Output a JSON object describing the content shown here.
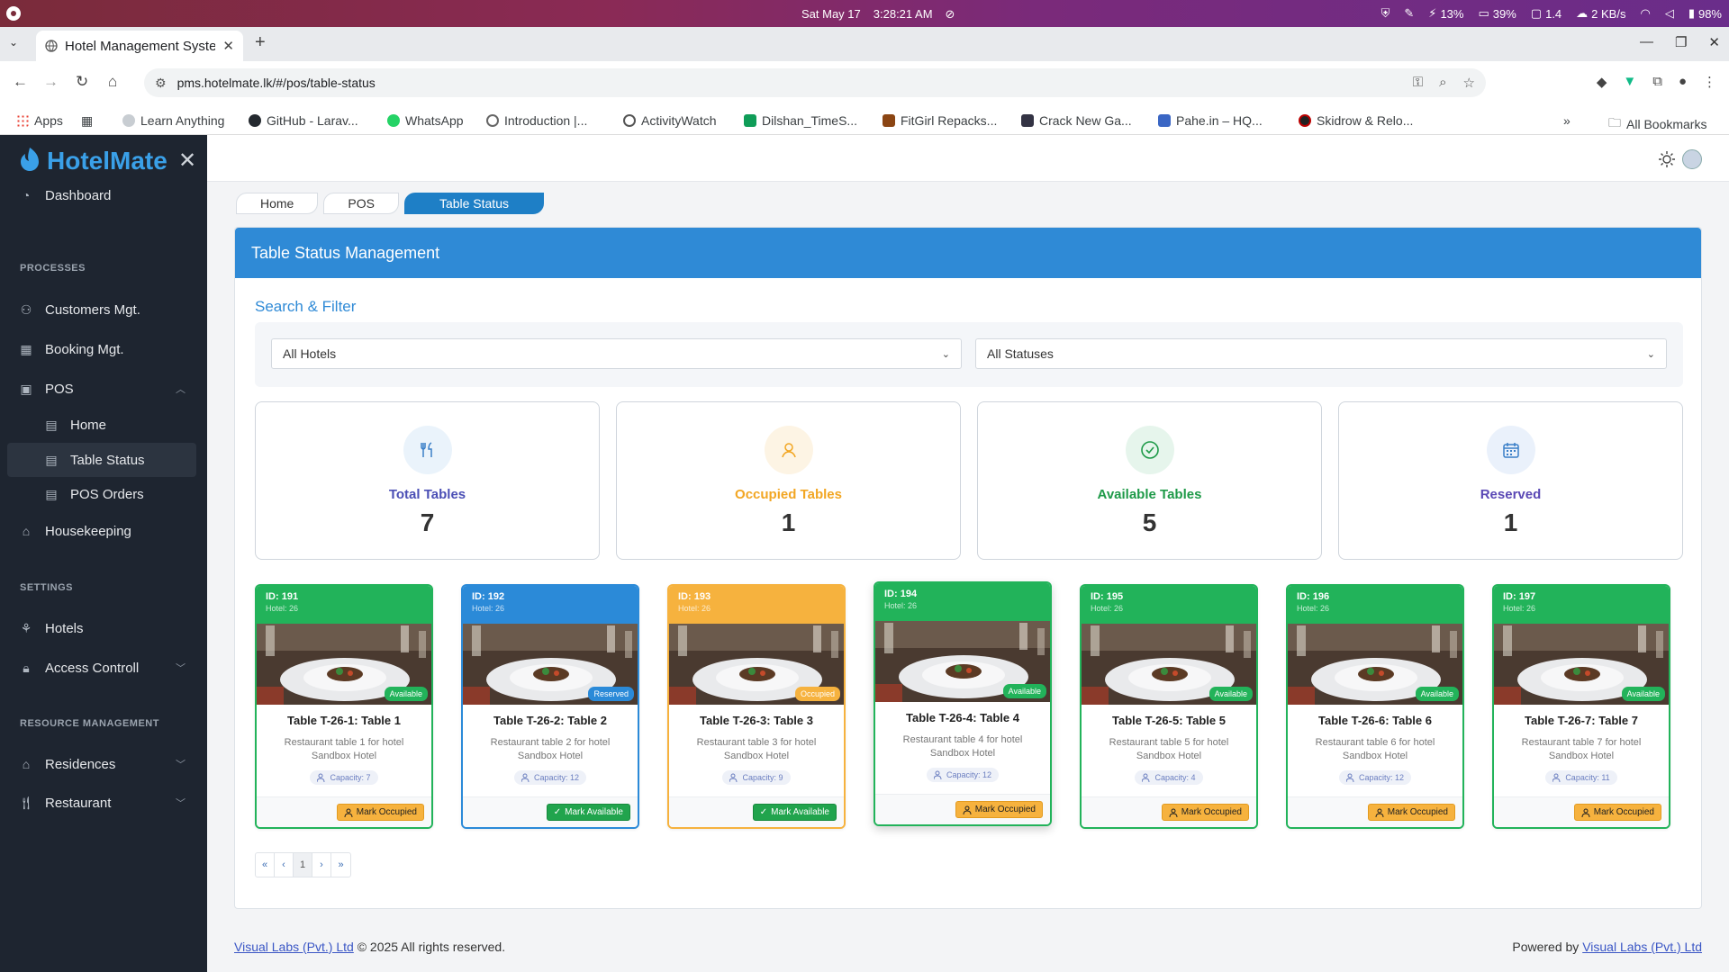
{
  "os": {
    "date": "Sat May 17",
    "time": "3:28:21 AM",
    "cpu": "13%",
    "mem": "39%",
    "load": "1.4",
    "net": "2 KB/s",
    "battery": "98%"
  },
  "browser": {
    "tab_title": "Hotel Management Syste",
    "url": "pms.hotelmate.lk/#/pos/table-status",
    "bookmarks": [
      {
        "label": "Apps",
        "color": "#e94235"
      },
      {
        "label": "",
        "color": "#5f6368"
      },
      {
        "label": "Learn Anything",
        "color": "#9aa0a6"
      },
      {
        "label": "GitHub - Larav...",
        "color": "#24292f"
      },
      {
        "label": "WhatsApp",
        "color": "#25d366"
      },
      {
        "label": "Introduction |...",
        "color": "#5f6368"
      },
      {
        "label": "ActivityWatch",
        "color": "#555"
      },
      {
        "label": "Dilshan_TimeS...",
        "color": "#0f9d58"
      },
      {
        "label": "FitGirl Repacks...",
        "color": "#8b4513"
      },
      {
        "label": "Crack New Ga...",
        "color": "#334"
      },
      {
        "label": "Pahe.in – HQ...",
        "color": "#3a66c4"
      },
      {
        "label": "Skidrow & Relo...",
        "color": "#b00"
      }
    ],
    "all_bookmarks": "All Bookmarks"
  },
  "sidebar": {
    "brand": "HotelMate",
    "dashboard": "Dashboard",
    "section_processes": "PROCESSES",
    "customers": "Customers Mgt.",
    "booking": "Booking Mgt.",
    "pos": "POS",
    "pos_home": "Home",
    "pos_table_status": "Table Status",
    "pos_orders": "POS Orders",
    "housekeeping": "Housekeeping",
    "section_settings": "SETTINGS",
    "hotels": "Hotels",
    "access": "Access Controll",
    "section_resource": "RESOURCE MANAGEMENT",
    "residences": "Residences",
    "restaurant": "Restaurant"
  },
  "breadcrumb": [
    "Home",
    "POS",
    "Table Status"
  ],
  "panel": {
    "title": "Table Status Management",
    "search_title": "Search & Filter",
    "hotel_filter": "All Hotels",
    "status_filter": "All Statuses"
  },
  "stats": [
    {
      "label": "Total Tables",
      "value": "7",
      "color": "#4b4fb5",
      "bg": "#eaf3fb",
      "icon": "utensils-icon"
    },
    {
      "label": "Occupied Tables",
      "value": "1",
      "color": "#f2a623",
      "bg": "#fdf4e4",
      "icon": "user-icon"
    },
    {
      "label": "Available Tables",
      "value": "5",
      "color": "#1e9a48",
      "bg": "#e6f5ec",
      "icon": "check-circle-icon"
    },
    {
      "label": "Reserved",
      "value": "1",
      "color": "#5a48b5",
      "bg": "#eaf1fb",
      "icon": "calendar-icon"
    }
  ],
  "tables": [
    {
      "id": "ID: 191",
      "hotel": "Hotel: 26",
      "status": "Available",
      "name": "Table T-26-1: Table 1",
      "desc": "Restaurant table 1 for hotel Sandbox Hotel",
      "capacity": "Capacity: 7",
      "action": "Mark Occupied"
    },
    {
      "id": "ID: 192",
      "hotel": "Hotel: 26",
      "status": "Reserved",
      "name": "Table T-26-2: Table 2",
      "desc": "Restaurant table 2 for hotel Sandbox Hotel",
      "capacity": "Capacity: 12",
      "action": "Mark Available"
    },
    {
      "id": "ID: 193",
      "hotel": "Hotel: 26",
      "status": "Occupied",
      "name": "Table T-26-3: Table 3",
      "desc": "Restaurant table 3 for hotel Sandbox Hotel",
      "capacity": "Capacity: 9",
      "action": "Mark Available"
    },
    {
      "id": "ID: 194",
      "hotel": "Hotel: 26",
      "status": "Available",
      "name": "Table T-26-4: Table 4",
      "desc": "Restaurant table 4 for hotel Sandbox Hotel",
      "capacity": "Capacity: 12",
      "action": "Mark Occupied"
    },
    {
      "id": "ID: 195",
      "hotel": "Hotel: 26",
      "status": "Available",
      "name": "Table T-26-5: Table 5",
      "desc": "Restaurant table 5 for hotel Sandbox Hotel",
      "capacity": "Capacity: 4",
      "action": "Mark Occupied"
    },
    {
      "id": "ID: 196",
      "hotel": "Hotel: 26",
      "status": "Available",
      "name": "Table T-26-6: Table 6",
      "desc": "Restaurant table 6 for hotel Sandbox Hotel",
      "capacity": "Capacity: 12",
      "action": "Mark Occupied"
    },
    {
      "id": "ID: 197",
      "hotel": "Hotel: 26",
      "status": "Available",
      "name": "Table T-26-7: Table 7",
      "desc": "Restaurant table 7 for hotel Sandbox Hotel",
      "capacity": "Capacity: 11",
      "action": "Mark Occupied"
    }
  ],
  "status_colors": {
    "Available": "#22b35a",
    "Reserved": "#2b8ad8",
    "Occupied": "#f6b23e"
  },
  "pager": [
    "«",
    "‹",
    "1",
    "›",
    "»"
  ],
  "footer": {
    "company": "Visual Labs (Pvt.) Ltd",
    "rights": "© 2025 All rights reserved.",
    "powered_by": "Powered by",
    "company_right": "Visual Labs (Pvt.) Ltd"
  }
}
